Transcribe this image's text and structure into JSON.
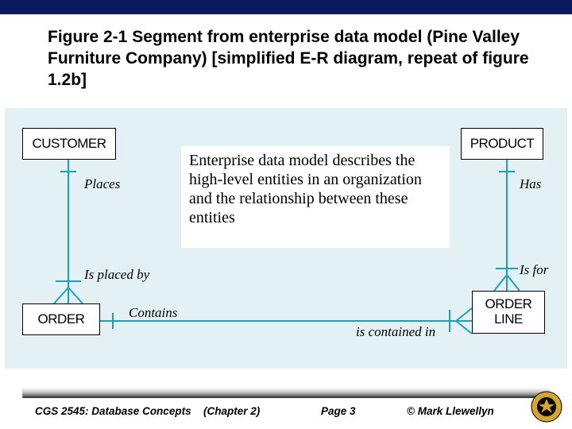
{
  "heading": "Figure 2-1 Segment from enterprise data model (Pine Valley Furniture Company) [simplified E-R diagram, repeat of figure 1.2b]",
  "callout": "Enterprise data model describes the high-level entities in an organization and the relationship between these entities",
  "entities": {
    "customer": "CUSTOMER",
    "product": "PRODUCT",
    "order": "ORDER",
    "orderline_l1": "ORDER",
    "orderline_l2": "LINE"
  },
  "relationships": {
    "places": "Places",
    "is_placed_by": "Is placed by",
    "has": "Has",
    "is_for": "Is for",
    "contains": "Contains",
    "is_contained_in": "is contained in"
  },
  "footer": {
    "course": "CGS 2545: Database Concepts",
    "chapter": "(Chapter 2)",
    "page": "Page 3",
    "copyright": "© Mark Llewellyn"
  }
}
